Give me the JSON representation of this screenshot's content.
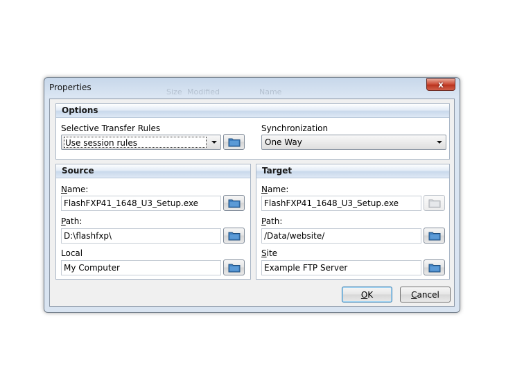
{
  "dialog": {
    "title": "Properties",
    "close_glyph": "x",
    "ghost_text": [
      "Size",
      "Modified",
      "Name"
    ]
  },
  "options": {
    "header": "Options",
    "rules_label": "Selective Transfer Rules",
    "rules_value": "Use session rules",
    "sync_label": "Synchronization",
    "sync_value": "One Way"
  },
  "source": {
    "header": "Source",
    "name_label_acc": "N",
    "name_label_rest": "ame:",
    "name_value": "FlashFXP41_1648_U3_Setup.exe",
    "path_label_acc": "P",
    "path_label_rest": "ath:",
    "path_value": "D:\\flashfxp\\",
    "local_label": "Local",
    "local_value": "My Computer"
  },
  "target": {
    "header": "Target",
    "name_label_acc": "N",
    "name_label_rest": "ame:",
    "name_value": "FlashFXP41_1648_U3_Setup.exe",
    "path_label_acc": "P",
    "path_label_rest": "ath:",
    "path_value": "/Data/website/",
    "site_label_acc": "S",
    "site_label_rest": "ite",
    "site_value": "Example FTP Server"
  },
  "buttons": {
    "ok_acc": "O",
    "ok_rest": "K",
    "cancel_acc": "C",
    "cancel_rest": "ancel"
  },
  "icons": {
    "browse": "folder-icon",
    "close": "close-icon",
    "dropdown": "chevron-down-icon"
  },
  "colors": {
    "folder_blue": "#3f7fc0",
    "folder_disabled": "#c9cdd2",
    "header_gradient_mid": "#c9d9ec"
  }
}
